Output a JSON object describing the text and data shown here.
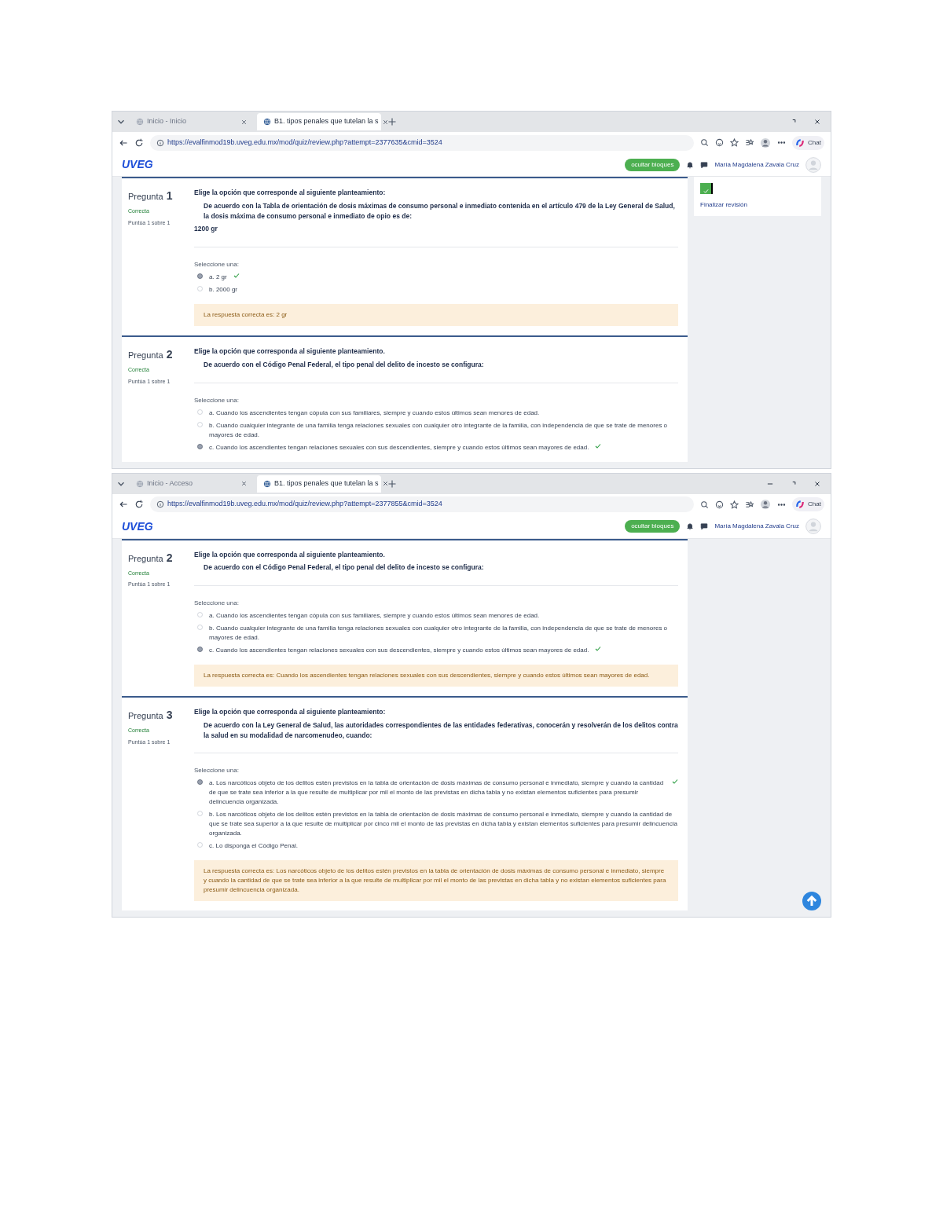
{
  "windows": [
    {
      "tabs": [
        {
          "title": "Inicio - Inicio",
          "selected": false
        },
        {
          "title": "B1. tipos penales que tutelan la s",
          "selected": true
        }
      ],
      "minimize_button": false,
      "url": "https://evalfinmod19b.uveg.edu.mx/mod/quiz/review.php?attempt=2377635&cmid=3524",
      "copilot_label": "Chat",
      "header": {
        "logo": "UVEG",
        "hide_button": "ocultar bloques",
        "user_name": "María Magdalena Zavala Cruz"
      },
      "nav_block": {
        "link": "Finalizar revisión"
      },
      "questions": [
        {
          "label": "Pregunta",
          "number": "1",
          "status": "Correcta",
          "score": "Puntúa 1 sobre 1",
          "prompt": "Elige la opción que corresponde al siguiente planteamiento:",
          "statement": "De acuerdo con la Tabla de orientación de dosis máximas de consumo personal e inmediato contenida en el artículo 479 de la Ley General de Salud, la dosis máxima de consumo personal e inmediato de opio es de:",
          "extra": "1200 gr",
          "select_label": "Seleccione una:",
          "options": [
            {
              "text": "a. 2 gr",
              "selected": true,
              "correct": true
            },
            {
              "text": "b. 2000 gr",
              "selected": false,
              "correct": false
            }
          ],
          "feedback": "La respuesta correcta es: 2 gr"
        },
        {
          "label": "Pregunta",
          "number": "2",
          "status": "Correcta",
          "score": "Puntúa 1 sobre 1",
          "prompt": "Elige la opción que corresponda al siguiente planteamiento.",
          "statement": "De acuerdo con el Código Penal Federal, el tipo penal del delito de incesto se configura:",
          "select_label": "Seleccione una:",
          "options": [
            {
              "text": "a. Cuando los ascendientes tengan cópula con sus familiares, siempre y cuando estos últimos sean menores de edad.",
              "selected": false,
              "correct": false
            },
            {
              "text": "b. Cuando cualquier integrante de una familia tenga relaciones sexuales con cualquier otro integrante de la familia, con independencia de que se trate de menores o mayores de edad.",
              "selected": false,
              "correct": false
            },
            {
              "text": "c. Cuando los ascendientes tengan relaciones sexuales con sus descendientes, siempre y cuando estos últimos sean mayores de edad.",
              "selected": true,
              "correct": true
            }
          ]
        }
      ]
    },
    {
      "tabs": [
        {
          "title": "Inicio - Acceso",
          "selected": false
        },
        {
          "title": "B1. tipos penales que tutelan la s",
          "selected": true
        }
      ],
      "minimize_button": true,
      "url": "https://evalfinmod19b.uveg.edu.mx/mod/quiz/review.php?attempt=2377855&cmid=3524",
      "copilot_label": "Chat",
      "header": {
        "logo": "UVEG",
        "hide_button": "ocultar bloques",
        "user_name": "María Magdalena Zavala Cruz"
      },
      "scroll_top_button": true,
      "questions": [
        {
          "label": "Pregunta",
          "number": "2",
          "status": "Correcta",
          "score": "Puntúa 1 sobre 1",
          "prompt": "Elige la opción que corresponda al siguiente planteamiento.",
          "statement": "De acuerdo con el Código Penal Federal, el tipo penal del delito de incesto se configura:",
          "select_label": "Seleccione una:",
          "options": [
            {
              "text": "a. Cuando los ascendientes tengan cópula con sus familiares, siempre y cuando estos últimos sean menores de edad.",
              "selected": false,
              "correct": false
            },
            {
              "text": "b. Cuando cualquier integrante de una familia tenga relaciones sexuales con cualquier otro integrante de la familia, con independencia de que se trate de menores o mayores de edad.",
              "selected": false,
              "correct": false
            },
            {
              "text": "c. Cuando los ascendientes tengan relaciones sexuales con sus descendientes, siempre y cuando estos últimos sean mayores de edad.",
              "selected": true,
              "correct": true
            }
          ],
          "feedback": "La respuesta correcta es: Cuando los ascendientes tengan relaciones sexuales con sus descendientes, siempre y cuando estos últimos sean mayores de edad."
        },
        {
          "label": "Pregunta",
          "number": "3",
          "status": "Correcta",
          "score": "Puntúa 1 sobre 1",
          "prompt": "Elige la opción que corresponda al siguiente planteamiento:",
          "statement": "De acuerdo con la Ley General de Salud, las autoridades correspondientes de las entidades federativas, conocerán y resolverán de los delitos contra la salud en su modalidad de narcomenudeo, cuando:",
          "select_label": "Seleccione una:",
          "options": [
            {
              "text": "a. Los narcóticos objeto de los delitos estén previstos en la tabla de orientación de dosis máximas de consumo personal e inmediato, siempre y cuando la cantidad de que se trate sea inferior a la que resulte de multiplicar por mil el monto de las previstas en dicha tabla y no existan elementos suficientes para presumir delincuencia organizada.",
              "selected": true,
              "correct": true
            },
            {
              "text": "b. Los narcóticos objeto de los delitos estén previstos en la tabla de orientación de dosis máximas de consumo personal e inmediato, siempre y cuando la cantidad de que se trate sea superior a la que resulte de multiplicar por cinco mil el monto de las previstas en dicha tabla y existan elementos suficientes para presumir delincuencia organizada.",
              "selected": false,
              "correct": false
            },
            {
              "text": "c. Lo disponga el Código Penal.",
              "selected": false,
              "correct": false
            }
          ],
          "feedback": "La respuesta correcta es: Los narcóticos objeto de los delitos estén previstos en la tabla de orientación de dosis máximas de consumo personal e inmediato, siempre y cuando la cantidad de que se trate sea inferior a la que resulte de multiplicar por mil el monto de las previstas en dicha tabla y no existan elementos suficientes para presumir delincuencia organizada."
        }
      ]
    }
  ]
}
